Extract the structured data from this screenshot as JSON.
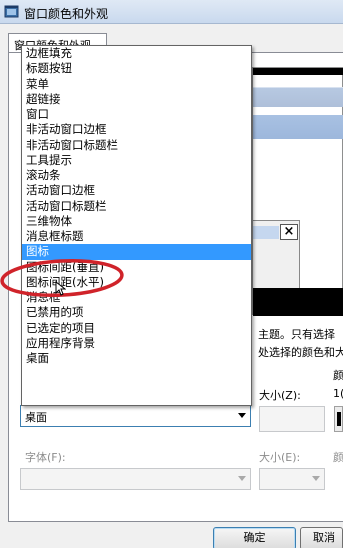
{
  "window": {
    "title": "窗口颜色和外观"
  },
  "tab": {
    "label": "窗口颜色和外观"
  },
  "description": {
    "line1": "主题。只有选择",
    "line2": "处选择的颜色和大"
  },
  "item": {
    "selected": "桌面",
    "size_label": "大小(Z):",
    "color1_label": "颜",
    "size_value": "1("
  },
  "font": {
    "label": "字体(F):",
    "size_label": "大小(E):",
    "color_label": "颜"
  },
  "buttons": {
    "ok": "确定",
    "cancel": "取消"
  },
  "dropdown": {
    "items": [
      "边框填充",
      "标题按钮",
      "菜单",
      "超链接",
      "窗口",
      "非活动窗口边框",
      "非活动窗口标题栏",
      "工具提示",
      "滚动条",
      "活动窗口边框",
      "活动窗口标题栏",
      "三维物体",
      "消息框标题",
      "图标",
      "图标间距(垂直)",
      "图标间距(水平)",
      "消息框",
      "已禁用的项",
      "已选定的项目",
      "应用程序背景",
      "桌面"
    ],
    "highlighted_index": 13
  },
  "colors": {
    "selection": "#3399ff",
    "annotation": "#d0232a"
  }
}
